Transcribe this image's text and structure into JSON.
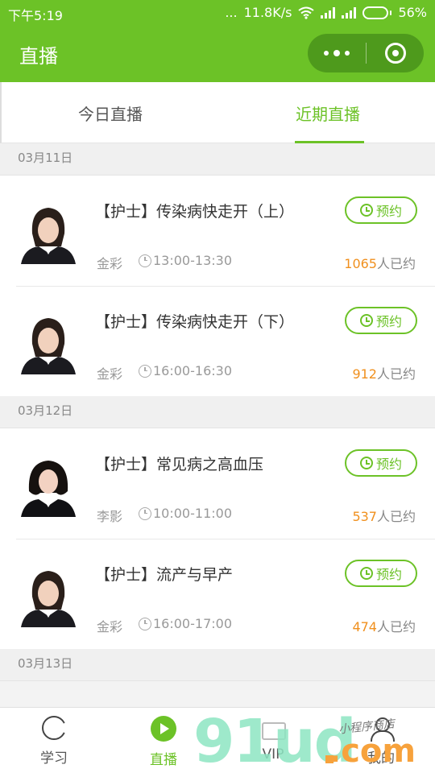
{
  "status_bar": {
    "time": "下午5:19",
    "dots": "...",
    "speed": "11.8K/s",
    "battery": "56%",
    "battery_level": 0.56
  },
  "nav": {
    "title": "直播"
  },
  "tabs": [
    {
      "label": "今日直播",
      "active": false
    },
    {
      "label": "近期直播",
      "active": true
    }
  ],
  "sections": [
    {
      "date": "03月11日",
      "items": [
        {
          "title": "【护士】传染病快走开（上）",
          "host": "金彩",
          "time": "13:00-13:30",
          "count": "1065",
          "count_suffix": "人已约",
          "button": "预约"
        },
        {
          "title": "【护士】传染病快走开（下）",
          "host": "金彩",
          "time": "16:00-16:30",
          "count": "912",
          "count_suffix": "人已约",
          "button": "预约"
        }
      ]
    },
    {
      "date": "03月12日",
      "items": [
        {
          "title": "【护士】常见病之高血压",
          "host": "李影",
          "time": "10:00-11:00",
          "count": "537",
          "count_suffix": "人已约",
          "button": "预约"
        },
        {
          "title": "【护士】流产与早产",
          "host": "金彩",
          "time": "16:00-17:00",
          "count": "474",
          "count_suffix": "人已约",
          "button": "预约"
        }
      ]
    },
    {
      "date": "03月13日",
      "items": []
    }
  ],
  "tabbar": [
    {
      "label": "学习",
      "icon": "study-icon",
      "active": false
    },
    {
      "label": "直播",
      "icon": "play-icon",
      "active": true
    },
    {
      "label": "VIP",
      "icon": "crown-icon",
      "active": false
    },
    {
      "label": "我的",
      "icon": "user-icon",
      "active": false
    }
  ],
  "watermark": {
    "text": "91ud",
    "suffix": ".com",
    "small": "小程序商店"
  },
  "colors": {
    "brand": "#6cc227",
    "count": "#f0901e"
  }
}
